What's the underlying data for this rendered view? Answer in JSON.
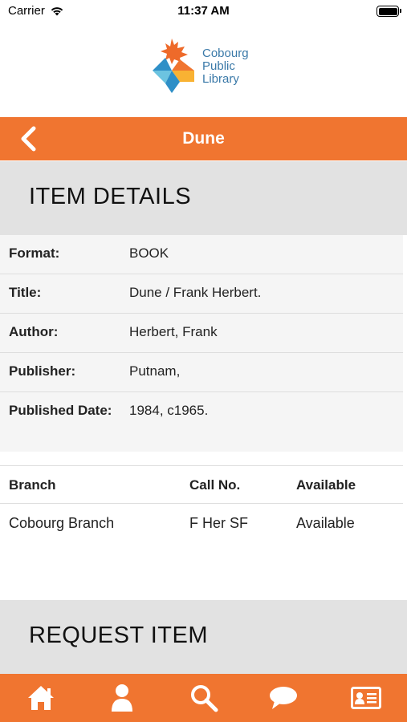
{
  "status_bar": {
    "carrier": "Carrier",
    "time": "11:37 AM"
  },
  "logo": {
    "line1": "Cobourg",
    "line2": "Public",
    "line3": "Library"
  },
  "nav": {
    "title": "Dune",
    "back_icon": "chevron-left-icon"
  },
  "item_details_header": "ITEM DETAILS",
  "details": [
    {
      "label": "Format:",
      "value": "BOOK"
    },
    {
      "label": "Title:",
      "value": "Dune / Frank Herbert."
    },
    {
      "label": "Author:",
      "value": "Herbert, Frank"
    },
    {
      "label": "Publisher:",
      "value": "Putnam,"
    },
    {
      "label": "Published Date:",
      "value": "1984, c1965."
    }
  ],
  "branch_table": {
    "headers": [
      "Branch",
      "Call No.",
      "Available"
    ],
    "rows": [
      [
        "Cobourg Branch",
        "F Her SF",
        "Available"
      ]
    ]
  },
  "request_header": "REQUEST ITEM",
  "tab_bar": {
    "icons": [
      "home-icon",
      "user-icon",
      "search-icon",
      "chat-icon",
      "id-card-icon"
    ]
  },
  "colors": {
    "accent": "#f07530",
    "header_bg": "#e2e2e2",
    "logo_text": "#3a79a8"
  }
}
